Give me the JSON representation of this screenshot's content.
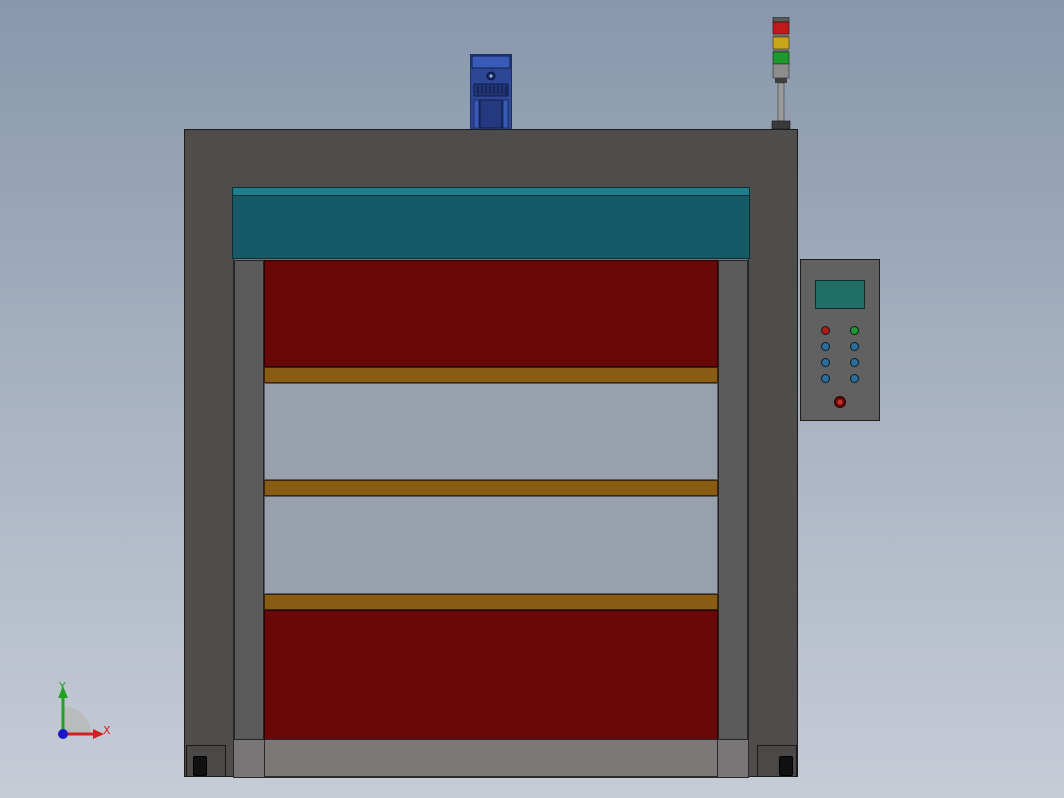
{
  "viewport": {
    "background_top": "#8897ac",
    "background_bottom": "#c6ccd6"
  },
  "model": {
    "frame_color": "#4f4d4c",
    "roll_housing_color": "#155a66",
    "curtain_panel_color": "#680808",
    "transparent_window_color": "#98a0ab",
    "wind_bar_color": "#8a5b12",
    "motor_color": "#2d4796"
  },
  "control_box": {
    "screen_color": "#1f6f66",
    "button_colors": {
      "start": "#b31919",
      "stop": "#1e9a33",
      "indicator": "#2a6e9e"
    },
    "emergency_stop_color": "#8a1010"
  },
  "signal_tower": {
    "colors": [
      "#c01a1a",
      "#c8a51a",
      "#1e9a2c"
    ]
  },
  "triad": {
    "x_label": "X",
    "y_label": "Y",
    "x_color": "#d22020",
    "y_color": "#22a022",
    "z_color": "#1818c8"
  }
}
